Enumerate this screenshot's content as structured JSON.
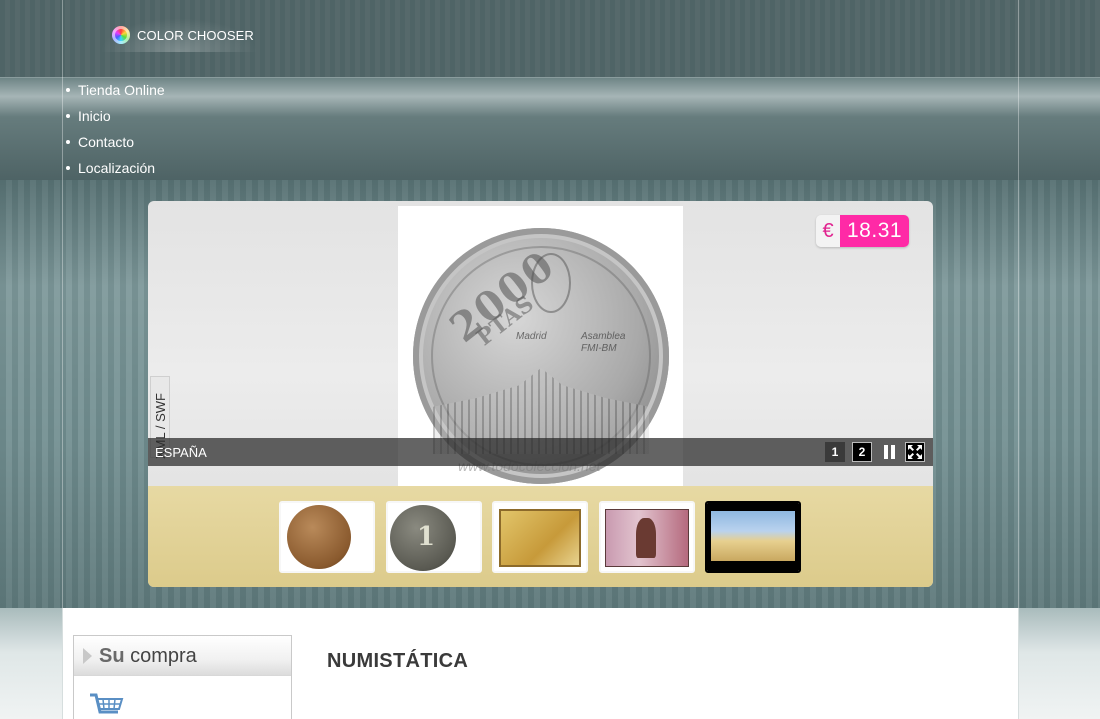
{
  "header": {
    "color_chooser_label": "COLOR CHOOSER"
  },
  "nav": {
    "items": [
      {
        "label": "Tienda Online"
      },
      {
        "label": "Inicio"
      },
      {
        "label": "Contacto"
      },
      {
        "label": "Localización"
      }
    ]
  },
  "slideshow": {
    "price_currency": "€",
    "price_value": "18.31",
    "side_tab_label": "XML / SWF",
    "caption": "ESPAÑA",
    "watermark": "www.todocoleccion.net",
    "coin_denomination": "2000",
    "coin_unit": "PTAS",
    "coin_legend_left": "Madrid",
    "coin_legend_right_1": "Asamblea",
    "coin_legend_right_2": "FMI-BM",
    "controls": {
      "page_1": "1",
      "page_2": "2"
    },
    "thumbnails": [
      {
        "name": "thumb-coin-copper"
      },
      {
        "name": "thumb-coin-1-franc",
        "text": "1"
      },
      {
        "name": "thumb-banknote-yellow"
      },
      {
        "name": "thumb-banknote-50"
      },
      {
        "name": "thumb-phonecard"
      }
    ],
    "colors": {
      "price_accent": "#ff2aa6",
      "thumb_strip": "#dccb8b"
    }
  },
  "sidebar": {
    "title_bold": "Su",
    "title_rest": " compra",
    "icon": "shopping-cart-icon"
  },
  "main": {
    "page_title": "NUMISTÁTICA"
  }
}
